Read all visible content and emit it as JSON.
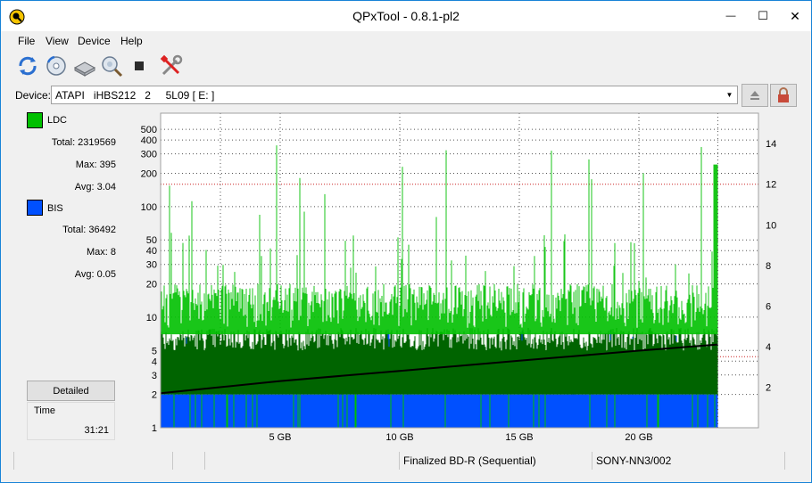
{
  "window": {
    "title": "QPxTool - 0.8.1-pl2",
    "minimize_glyph": "—",
    "maximize_glyph": "☐",
    "close_glyph": "✕"
  },
  "menu": {
    "items": [
      {
        "label": "File"
      },
      {
        "label": "View"
      },
      {
        "label": "Device"
      },
      {
        "label": "Help"
      }
    ]
  },
  "toolbar": {
    "icons": [
      "refresh-icon",
      "disc-info-icon",
      "device-info-icon",
      "scan-icon",
      "stop-icon",
      "settings-icon"
    ]
  },
  "device": {
    "label": "Device:",
    "value": "ATAPI   iHBS212   2     5L09 [ E: ]",
    "eject_icon": "eject-icon",
    "lock_icon": "lock-icon"
  },
  "ldc": {
    "label": "LDC",
    "color": "#00c000",
    "total": "Total: 2319569",
    "max": "Max: 395",
    "avg": "Avg: 3.04"
  },
  "bis": {
    "label": "BIS",
    "color": "#0050ff",
    "total": "Total: 36492",
    "max": "Max: 8",
    "avg": "Avg: 0.05"
  },
  "detailed_button": "Detailed",
  "time": {
    "label": "Time",
    "value": "31:21"
  },
  "status": {
    "cell1": "",
    "cell2": "",
    "disc_type": "Finalized BD-R (Sequential)",
    "media_id": "SONY-NN3/002"
  },
  "chart_data": {
    "type": "area",
    "x_unit": "GB",
    "x_ticks": [
      "5 GB",
      "10 GB",
      "15 GB",
      "20 GB"
    ],
    "x_tick_values": [
      5,
      10,
      15,
      20
    ],
    "xlim": [
      0,
      25
    ],
    "left_axis": {
      "scale": "log",
      "ticks": [
        "1",
        "2",
        "3",
        "4",
        "5",
        "10",
        "20",
        "30",
        "40",
        "50",
        "100",
        "200",
        "300",
        "400",
        "500"
      ],
      "tick_values": [
        1,
        2,
        3,
        4,
        5,
        10,
        20,
        30,
        40,
        50,
        100,
        200,
        300,
        400,
        500
      ],
      "ylim": [
        1,
        700
      ]
    },
    "right_axis": {
      "ticks": [
        "2",
        "4",
        "6",
        "8",
        "10",
        "12",
        "14"
      ],
      "tick_values": [
        2,
        4,
        6,
        8,
        10,
        12,
        14
      ],
      "ylim": [
        0,
        15.5
      ]
    },
    "data_end_gb": 23.3,
    "series": [
      {
        "name": "LDC",
        "color": "#00c000",
        "typical": 10,
        "max": 395
      },
      {
        "name": "BIS",
        "color": "#0050ff",
        "typical": 2,
        "max": 8
      },
      {
        "name": "speed",
        "color": "#000000",
        "x": [
          0,
          5,
          10,
          15,
          20,
          23.3
        ],
        "y": [
          1.7,
          2.3,
          2.8,
          3.3,
          3.8,
          4.1
        ]
      }
    ],
    "grid": true,
    "red_guide_values_right": [
      3.5,
      12.0
    ]
  }
}
